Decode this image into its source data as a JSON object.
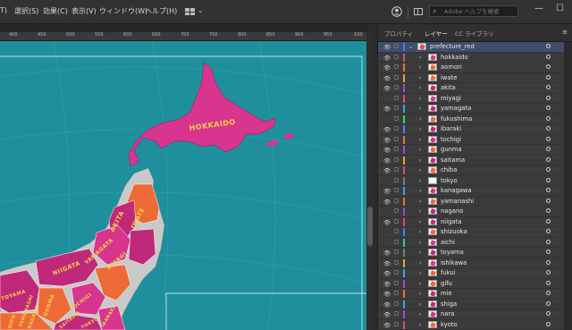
{
  "menubar": {
    "items": [
      "T)",
      "選択(S)",
      "効果(C)",
      "表示(V)",
      "ウィンドウ(W)",
      "ヘルプ(H)"
    ],
    "search_placeholder": "Adobe ヘルプを検索"
  },
  "window_controls": {
    "minimize": "—",
    "maximize": "☐"
  },
  "ruler": {
    "ticks": [
      "400",
      "450",
      "500",
      "550",
      "600",
      "650",
      "700",
      "750",
      "800",
      "850",
      "900",
      "950",
      "100"
    ]
  },
  "map": {
    "labels": [
      "HOKKAIDO",
      "AKITA",
      "IWATE",
      "YAMAGATA",
      "MIYAGI",
      "NIIGATA",
      "TOYAMA",
      "TOCHIGI",
      "GUNMA",
      "GIFU",
      "YAMANASHI",
      "NAGANO",
      "SAITAMA",
      "IBARAKI",
      "TOKYO"
    ],
    "colors": {
      "sea": "#1f8f9e",
      "hokkaido": "#d8358e",
      "land_gray": "#c9c9c9",
      "orange": "#ee6a37",
      "magenta": "#c0297a"
    }
  },
  "panel": {
    "tabs": [
      "プロパティ",
      "レイヤー",
      "CC ライブラリ"
    ],
    "active_tab": "レイヤー",
    "menu_icon": "≡",
    "layers": [
      {
        "name": "prefecture_red",
        "color": "#4f7cff",
        "thumb": "#e05050",
        "top": true,
        "visible": true
      },
      {
        "name": "hokkaido",
        "color": "#d94a8c",
        "thumb": "#d8358e",
        "visible": true
      },
      {
        "name": "aomori",
        "color": "#e07a2a",
        "thumb": "#ee6a37",
        "visible": true
      },
      {
        "name": "iwate",
        "color": "#d8b02a",
        "thumb": "#ee6a37",
        "visible": true
      },
      {
        "name": "akita",
        "color": "#9a4ad9",
        "thumb": "#c0297a",
        "visible": true
      },
      {
        "name": "miyagi",
        "color": "#d94a8c",
        "thumb": "#d8358e",
        "visible": false
      },
      {
        "name": "yamagata",
        "color": "#2ab0d8",
        "thumb": "#c0297a",
        "visible": true
      },
      {
        "name": "fukushima",
        "color": "#2ad88a",
        "thumb": "#ee6a37",
        "visible": false
      },
      {
        "name": "ibaraki",
        "color": "#4f7cff",
        "thumb": "#c0297a",
        "visible": true
      },
      {
        "name": "tochigi",
        "color": "#e07a2a",
        "thumb": "#d8358e",
        "visible": true
      },
      {
        "name": "gunma",
        "color": "#9a4ad9",
        "thumb": "#ee6a37",
        "visible": true
      },
      {
        "name": "saitama",
        "color": "#d8b02a",
        "thumb": "#c0297a",
        "visible": true
      },
      {
        "name": "chiba",
        "color": "#d94a8c",
        "thumb": "#ee6a37",
        "visible": true
      },
      {
        "name": "tokyo",
        "color": "#7a7a7a",
        "thumb": "#ffffff",
        "visible": false
      },
      {
        "name": "kanagawa",
        "color": "#2ab0d8",
        "thumb": "#d8358e",
        "visible": true
      },
      {
        "name": "yamanashi",
        "color": "#e07a2a",
        "thumb": "#ee6a37",
        "visible": true
      },
      {
        "name": "nagano",
        "color": "#9a4ad9",
        "thumb": "#c0297a",
        "visible": false
      },
      {
        "name": "niigata",
        "color": "#d94a8c",
        "thumb": "#c0297a",
        "visible": true
      },
      {
        "name": "shizuoka",
        "color": "#4f7cff",
        "thumb": "#ee6a37",
        "visible": false
      },
      {
        "name": "aichi",
        "color": "#2ad88a",
        "thumb": "#d8358e",
        "visible": false
      },
      {
        "name": "toyama",
        "color": "#7a7a7a",
        "thumb": "#c0297a",
        "visible": true
      },
      {
        "name": "ishikawa",
        "color": "#d8b02a",
        "thumb": "#d8358e",
        "visible": true
      },
      {
        "name": "fukui",
        "color": "#2ab0d8",
        "thumb": "#ee6a37",
        "visible": true
      },
      {
        "name": "gifu",
        "color": "#9a4ad9",
        "thumb": "#ee6a37",
        "visible": true
      },
      {
        "name": "mie",
        "color": "#e07a2a",
        "thumb": "#c0297a",
        "visible": true
      },
      {
        "name": "shiga",
        "color": "#2ab0d8",
        "thumb": "#c0297a",
        "visible": true
      },
      {
        "name": "nara",
        "color": "#9a4ad9",
        "thumb": "#d8358e",
        "visible": true
      },
      {
        "name": "kyoto",
        "color": "#d94a8c",
        "thumb": "#ee6a37",
        "visible": true
      }
    ]
  }
}
